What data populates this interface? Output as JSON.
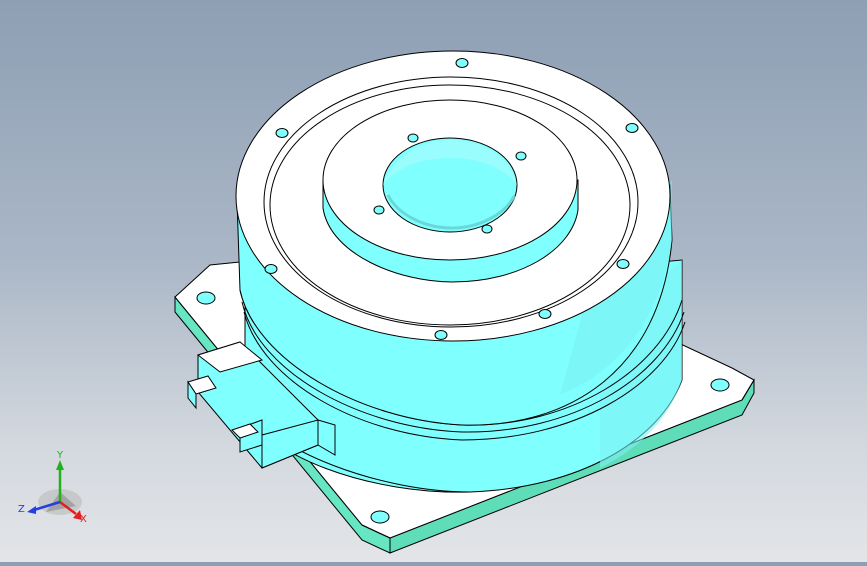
{
  "viewport": {
    "background_top": "#8e9fb4",
    "background_bottom": "#e3e5e8"
  },
  "model": {
    "body_color": "#80ffff",
    "face_color": "#ffffff",
    "plate_edge_color": "#66e6c2",
    "edge_color": "#000000"
  },
  "triad": {
    "x_label": "X",
    "y_label": "Y",
    "z_label": "Z",
    "x_color": "#e02020",
    "y_color": "#20b020",
    "z_color": "#2040e0"
  }
}
